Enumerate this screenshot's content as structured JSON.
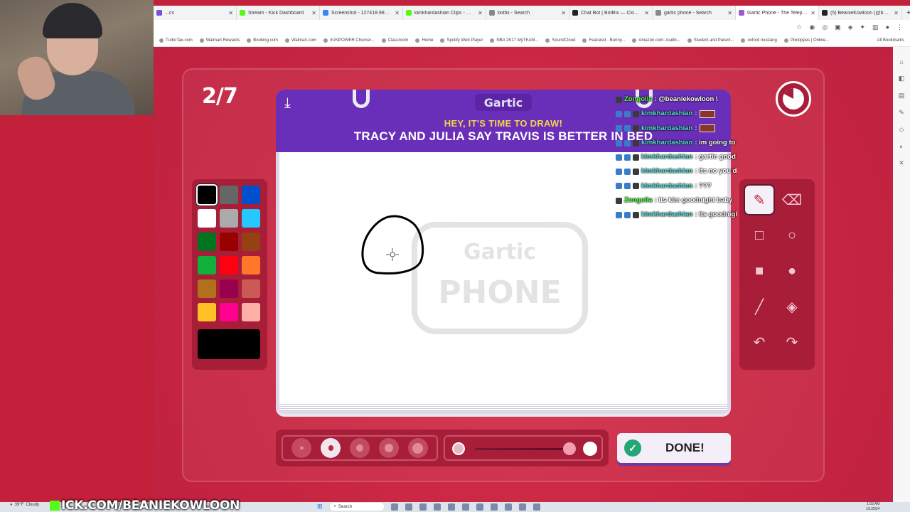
{
  "browser": {
    "tabs": [
      {
        "title": "...cs",
        "color": "#7b4fd6"
      },
      {
        "title": "Stream - Kick Dashboard",
        "color": "#53fc18"
      },
      {
        "title": "Screenshot - 127418.984913s",
        "color": "#3b82f6"
      },
      {
        "title": "kimkhardashian Clips - Watch",
        "color": "#53fc18"
      },
      {
        "title": "botfix - Search",
        "color": "#888888"
      },
      {
        "title": "Chat Bot | BotRix — Cloud St",
        "color": "#222222"
      },
      {
        "title": "gartic phone - Search",
        "color": "#888888"
      },
      {
        "title": "Gartic Phone - The Telephone",
        "color": "#9d5bd2"
      },
      {
        "title": "(5) BeanieKowloon (@bnn7...",
        "color": "#222222"
      }
    ],
    "active_tab": 7,
    "bookmarks": [
      "TurboTax.com",
      "Walmart Rewards",
      "Booking.com",
      "Walmart.com",
      "#UNPOWER Churner...",
      "Classroom",
      "Home",
      "Spotify Web Player",
      "NBA 2K17 MyTEAM...",
      "SoundCloud",
      "Featured - Bunny...",
      "Amazon.com: Audib...",
      "Student and Parent...",
      "oxford mustang",
      "Pixiloppes | Online..."
    ],
    "all_bookmarks": "All Bookmarks"
  },
  "game": {
    "round": "2/7",
    "logo": "Gartic",
    "prompt_title": "HEY, IT'S TIME TO DRAW!",
    "prompt_text": "TRACY AND JULIA SAY TRAVIS IS BETTER IN BED",
    "done_label": "DONE!",
    "watermark_top": "Gartic",
    "watermark_bottom": "PHONE",
    "palette": [
      "#000000",
      "#666666",
      "#0050cd",
      "#ffffff",
      "#aaaaaa",
      "#26c9ff",
      "#017420",
      "#990000",
      "#964112",
      "#11b03c",
      "#ff0013",
      "#ff7829",
      "#b0701c",
      "#99004e",
      "#cb5a57",
      "#ffc126",
      "#ff008f",
      "#feafa8"
    ],
    "selected_color": "#000000",
    "tools": [
      "pencil-icon",
      "eraser-icon",
      "rectangle-outline-icon",
      "circle-outline-icon",
      "rectangle-filled-icon",
      "circle-filled-icon",
      "line-icon",
      "fill-bucket-icon",
      "undo-icon",
      "redo-icon"
    ],
    "brush_sizes": [
      1,
      2,
      3,
      4,
      5
    ],
    "selected_size": 2
  },
  "chat": [
    {
      "user": "Zongolia",
      "user_color": "green",
      "text": ": @beaniekowloon \\"
    },
    {
      "user": "kimkhardashian",
      "user_color": "cyan",
      "text": ":",
      "emote": true
    },
    {
      "user": "kimkhardashian",
      "user_color": "cyan",
      "text": ":",
      "emote": true
    },
    {
      "user": "kimkhardashian",
      "user_color": "cyan",
      "text": ": im going to bed"
    },
    {
      "user": "kimkhardashian",
      "user_color": "cyan",
      "text": ": gartic good"
    },
    {
      "user": "kimkhardashian",
      "user_color": "cyan",
      "text": ": its no you dumb jew"
    },
    {
      "user": "kimkhardashian",
      "user_color": "cyan",
      "text": ": ???"
    },
    {
      "user": "Zongolia",
      "user_color": "green",
      "text": ": its kim goodnight baby"
    },
    {
      "user": "kimkhardashian",
      "user_color": "cyan",
      "text": ": its goodnight zong"
    }
  ],
  "stream_banner": "ICK.COM/BEANIEKOWLOON",
  "taskbar": {
    "weather": "39°F",
    "weather_sub": "Cloudy",
    "search_label": "Search",
    "time": "1:03 AM",
    "date": "1/1/2024"
  }
}
